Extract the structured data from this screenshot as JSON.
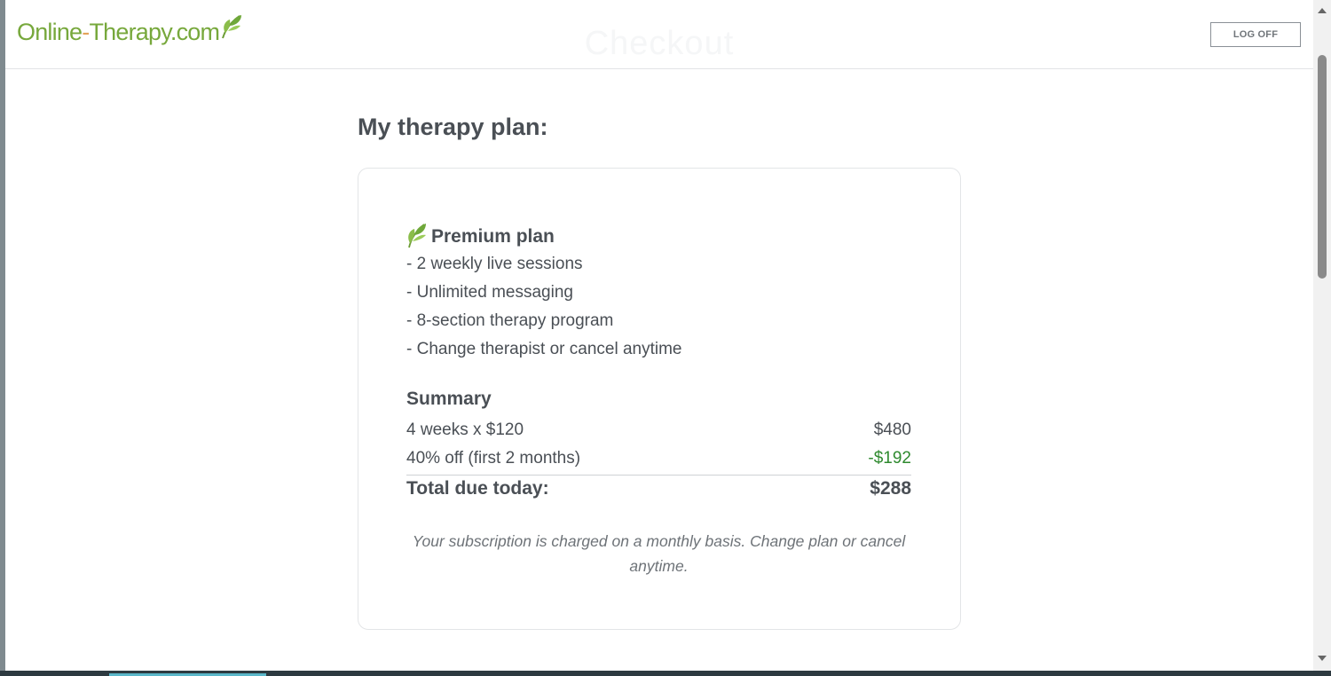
{
  "header": {
    "logo": {
      "part1": "Online",
      "part2": "-",
      "part3": "Therapy.com"
    },
    "faded_title": "Checkout",
    "logoff_label": "LOG OFF"
  },
  "main": {
    "heading": "My therapy plan:",
    "plan": {
      "name": "Premium plan",
      "features": [
        "- 2 weekly live sessions",
        "- Unlimited messaging",
        "- 8-section therapy program",
        "- Change therapist or cancel anytime"
      ]
    },
    "summary": {
      "title": "Summary",
      "rows": [
        {
          "label": "4 weeks x $120",
          "value": "$480"
        },
        {
          "label": "40% off (first 2 months)",
          "value": "-$192"
        }
      ],
      "total_label": "Total due today:",
      "total_value": "$288"
    },
    "note": "Your subscription is charged on a monthly basis. Change plan or cancel anytime."
  },
  "colors": {
    "brand_green": "#77a83c",
    "brand_orange": "#e4a25a",
    "discount_green": "#2f8a2f",
    "text": "#4a4f55"
  },
  "icons": [
    "leaf-icon",
    "chevron-up-icon",
    "chevron-down-icon"
  ]
}
